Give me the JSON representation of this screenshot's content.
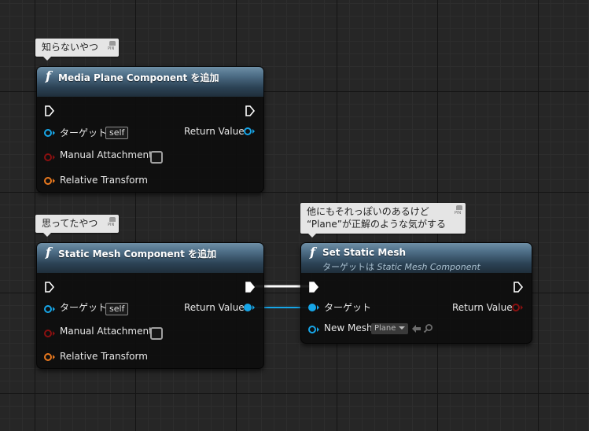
{
  "comments": {
    "top": "知らないやつ",
    "middle": "思ってたやつ",
    "right_line1": "他にもそれっぽいのあるけど",
    "right_line2": "“Plane”が正解のような気がする",
    "pin_label": "PIN"
  },
  "nodes": {
    "media_plane": {
      "title": "Media Plane Component を追加",
      "target_label": "ターゲット",
      "self_label": "self",
      "return_label": "Return Value",
      "manual_attachment_label": "Manual Attachment",
      "relative_transform_label": "Relative Transform"
    },
    "static_mesh": {
      "title": "Static Mesh Component を追加",
      "target_label": "ターゲット",
      "self_label": "self",
      "return_label": "Return Value",
      "manual_attachment_label": "Manual Attachment",
      "relative_transform_label": "Relative Transform"
    },
    "set_static_mesh": {
      "title": "Set Static Mesh",
      "subtitle_prefix": "ターゲットは",
      "subtitle_target": "Static Mesh Component",
      "target_label": "ターゲット",
      "return_label": "Return Value",
      "new_mesh_label": "New Mesh",
      "new_mesh_value": "Plane"
    }
  },
  "icons": {
    "function": "f",
    "exec": "exec-pin-icon",
    "data": "data-pin-icon",
    "browse": "use-asset-arrow-icon",
    "search": "search-icon",
    "comment_pin": "pin-icon"
  },
  "colors": {
    "object_pin": "#17a6e8",
    "bool_pin": "#8a1010",
    "transform_pin": "#e8781e",
    "exec_pin": "#ffffff",
    "header_top": "#6e8fa6",
    "header_bottom": "#1f2e3a",
    "comment_bg": "#e5e5e5"
  }
}
